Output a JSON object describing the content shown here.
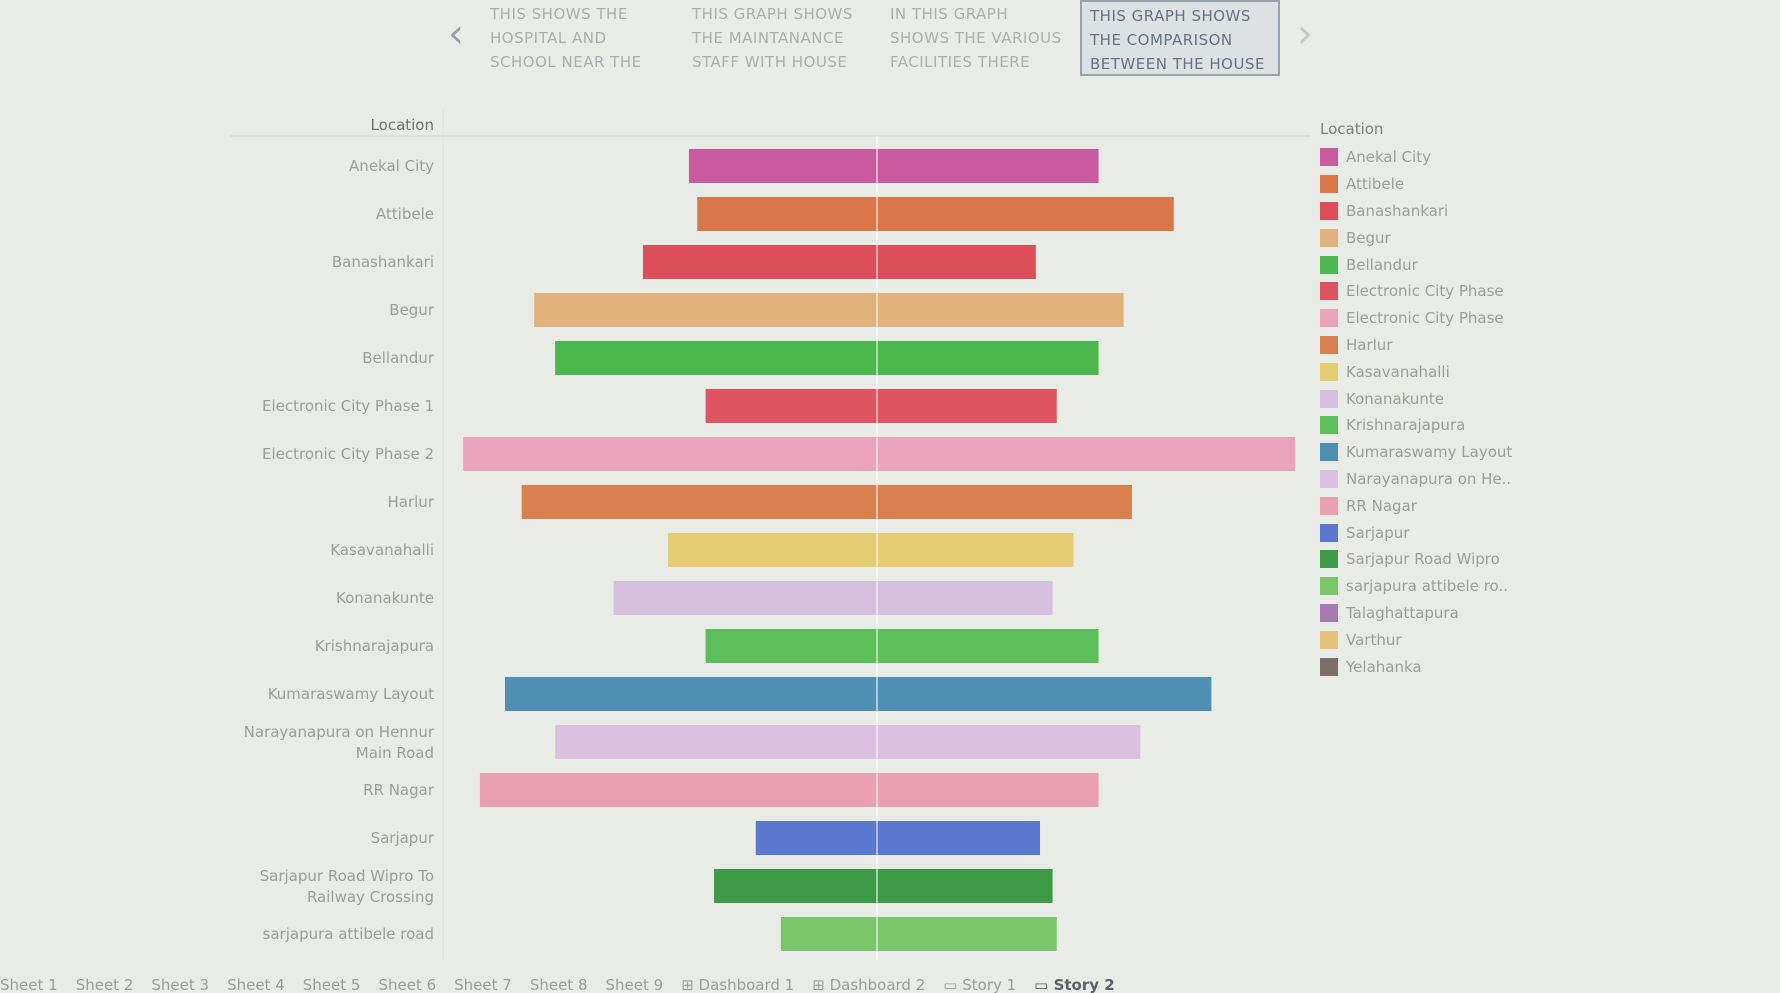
{
  "story": {
    "points": [
      "THIS SHOWS THE\nHOSPITAL AND\nSCHOOL NEAR THE",
      "THIS GRAPH SHOWS\nTHE MAINTANANCE\nSTAFF WITH HOUSE",
      "IN THIS GRAPH\nSHOWS THE VARIOUS\nFACILITIES  THERE",
      "THIS GRAPH SHOWS\nTHE COMPARISON\nBETWEEN THE HOUSE"
    ],
    "active_index": 3,
    "prev_icon": "chevron-left-icon",
    "next_icon": "chevron-right-icon"
  },
  "chart_data": {
    "type": "bar",
    "orientation": "horizontal",
    "row_header": "Location",
    "categories": [
      "Anekal City",
      "Attibele",
      "Banashankari",
      "Begur",
      "Bellandur",
      "Electronic City Phase 1",
      "Electronic City Phase 2",
      "Harlur",
      "Kasavanahalli",
      "Konanakunte",
      "Krishnarajapura",
      "Kumaraswamy Layout",
      "Narayanapura on Hennur Main Road",
      "RR Nagar",
      "Sarjapur",
      "Sarjapur Road Wipro To Railway Crossing",
      "sarjapura attibele road"
    ],
    "ranges": [
      [
        -0.45,
        0.53
      ],
      [
        -0.43,
        0.71
      ],
      [
        -0.56,
        0.38
      ],
      [
        -0.82,
        0.59
      ],
      [
        -0.77,
        0.53
      ],
      [
        -0.41,
        0.43
      ],
      [
        -0.99,
        1.0
      ],
      [
        -0.85,
        0.61
      ],
      [
        -0.5,
        0.47
      ],
      [
        -0.63,
        0.42
      ],
      [
        -0.41,
        0.53
      ],
      [
        -0.89,
        0.8
      ],
      [
        -0.77,
        0.63
      ],
      [
        -0.95,
        0.53
      ],
      [
        -0.29,
        0.39
      ],
      [
        -0.39,
        0.42
      ],
      [
        -0.23,
        0.43
      ]
    ],
    "colors": [
      "#c95aa0",
      "#d9764a",
      "#dc4f5a",
      "#e2b27c",
      "#4cb74c",
      "#de5360",
      "#e9a4bc",
      "#d8804e",
      "#e3cc72",
      "#d7bfe0",
      "#5cbf5a",
      "#4f8fb4",
      "#dcc0e2",
      "#e9a0b2",
      "#5a78d0",
      "#3e9a46",
      "#7ac46a"
    ],
    "label_lines": [
      [
        "Anekal City"
      ],
      [
        "Attibele"
      ],
      [
        "Banashankari"
      ],
      [
        "Begur"
      ],
      [
        "Bellandur"
      ],
      [
        "Electronic City Phase 1"
      ],
      [
        "Electronic City Phase 2"
      ],
      [
        "Harlur"
      ],
      [
        "Kasavanahalli"
      ],
      [
        "Konanakunte"
      ],
      [
        "Krishnarajapura"
      ],
      [
        "Kumaraswamy Layout"
      ],
      [
        "Narayanapura on Hennur",
        "Main Road"
      ],
      [
        "RR Nagar"
      ],
      [
        "Sarjapur"
      ],
      [
        "Sarjapur Road Wipro To",
        "Railway Crossing"
      ],
      [
        "sarjapura attibele road"
      ]
    ],
    "xlim": [
      -1,
      1
    ]
  },
  "legend": {
    "title": "Location",
    "items": [
      {
        "label": "Anekal City",
        "color": "#c95aa0"
      },
      {
        "label": "Attibele",
        "color": "#d9764a"
      },
      {
        "label": "Banashankari",
        "color": "#dc4f5a"
      },
      {
        "label": "Begur",
        "color": "#e2b27c"
      },
      {
        "label": "Bellandur",
        "color": "#4cb74c"
      },
      {
        "label": "Electronic City Phase",
        "color": "#de5360"
      },
      {
        "label": "Electronic City Phase",
        "color": "#e9a4bc"
      },
      {
        "label": "Harlur",
        "color": "#d8804e"
      },
      {
        "label": "Kasavanahalli",
        "color": "#e3cc72"
      },
      {
        "label": "Konanakunte",
        "color": "#d7bfe0"
      },
      {
        "label": "Krishnarajapura",
        "color": "#5cbf5a"
      },
      {
        "label": "Kumaraswamy Layout",
        "color": "#4f8fb4"
      },
      {
        "label": "Narayanapura on He..",
        "color": "#dcc0e2"
      },
      {
        "label": "RR Nagar",
        "color": "#e9a0b2"
      },
      {
        "label": "Sarjapur",
        "color": "#5a78d0"
      },
      {
        "label": "Sarjapur Road Wipro",
        "color": "#3e9a46"
      },
      {
        "label": "sarjapura attibele ro..",
        "color": "#7ac46a"
      },
      {
        "label": "Talaghattapura",
        "color": "#a57cb2"
      },
      {
        "label": "Varthur",
        "color": "#e6c27a"
      },
      {
        "label": "Yelahanka",
        "color": "#7b6f68"
      }
    ]
  },
  "tabs": [
    {
      "label": "Sheet 1",
      "icon": ""
    },
    {
      "label": "Sheet 2",
      "icon": ""
    },
    {
      "label": "Sheet 3",
      "icon": ""
    },
    {
      "label": "Sheet 4",
      "icon": ""
    },
    {
      "label": "Sheet 5",
      "icon": ""
    },
    {
      "label": "Sheet 6",
      "icon": ""
    },
    {
      "label": "Sheet 7",
      "icon": ""
    },
    {
      "label": "Sheet 8",
      "icon": ""
    },
    {
      "label": "Sheet 9",
      "icon": ""
    },
    {
      "label": "Dashboard 1",
      "icon": "dashboard-icon"
    },
    {
      "label": "Dashboard 2",
      "icon": "dashboard-icon"
    },
    {
      "label": "Story 1",
      "icon": "story-icon"
    },
    {
      "label": "Story 2",
      "icon": "story-icon",
      "active": true
    }
  ]
}
